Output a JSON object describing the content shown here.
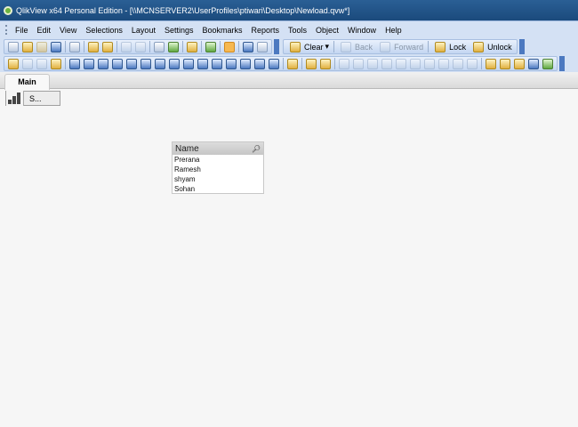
{
  "window": {
    "title": "QlikView x64 Personal Edition - [\\\\MCNSERVER2\\UserProfiles\\ptiwari\\Desktop\\Newload.qvw*]"
  },
  "menu": [
    "File",
    "Edit",
    "View",
    "Selections",
    "Layout",
    "Settings",
    "Bookmarks",
    "Reports",
    "Tools",
    "Object",
    "Window",
    "Help"
  ],
  "toolbar": {
    "clear": "Clear",
    "back": "Back",
    "forward": "Forward",
    "lock": "Lock",
    "unlock": "Unlock"
  },
  "tabs": [
    {
      "label": "Main"
    }
  ],
  "minimized_object": {
    "label": "S..."
  },
  "listbox": {
    "title": "Name",
    "items": [
      "Prerana",
      "Ramesh",
      "shyam",
      "Sohan"
    ]
  }
}
